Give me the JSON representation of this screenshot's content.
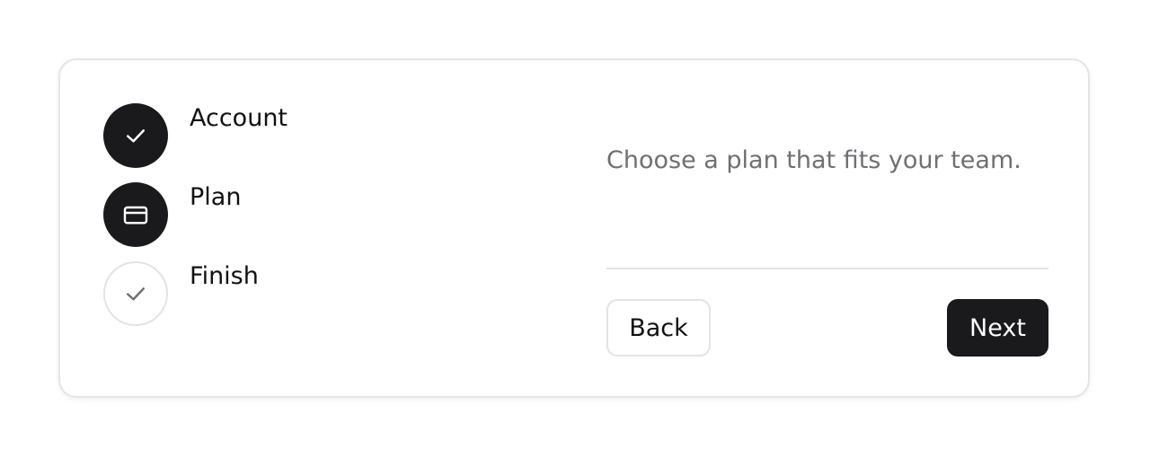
{
  "wizard": {
    "steps": [
      {
        "label": "Account",
        "status": "complete",
        "icon": "check-icon"
      },
      {
        "label": "Plan",
        "status": "current",
        "icon": "credit-card-icon"
      },
      {
        "label": "Finish",
        "status": "pending",
        "icon": "check-icon"
      }
    ],
    "description": "Choose a plan that fits your team.",
    "back_label": "Back",
    "next_label": "Next"
  },
  "colors": {
    "accent": "#1a1a1c",
    "muted_text": "#6f6f74",
    "border": "#e3e3e3"
  }
}
